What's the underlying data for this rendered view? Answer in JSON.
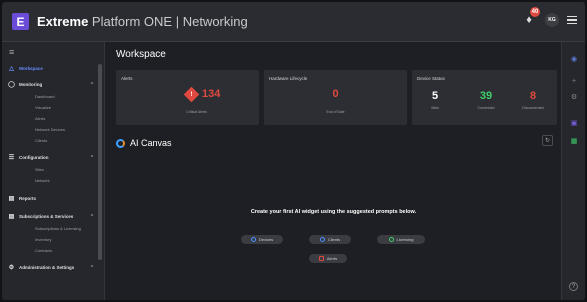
{
  "header": {
    "brand_bold": "Extreme",
    "brand_rest": " Platform ONE | Networking",
    "logo_letter": "E",
    "notification_count": "40",
    "avatar_initials": "KG"
  },
  "sidebar": {
    "items": [
      {
        "label": "Workspace",
        "icon": "workspace-icon",
        "active": true
      },
      {
        "label": "Monitoring",
        "icon": "monitor-icon",
        "expanded": true,
        "children": [
          "Dashboard",
          "Visualize",
          "Alerts",
          "Network Devices",
          "Clients"
        ]
      },
      {
        "label": "Configuration",
        "icon": "config-icon",
        "expanded": true,
        "children": [
          "Sites",
          "Network"
        ]
      },
      {
        "label": "Reports",
        "icon": "reports-icon"
      },
      {
        "label": "Subscriptions & Services",
        "icon": "subscriptions-icon",
        "expanded": true,
        "children": [
          "Subscriptions & Licensing",
          "Inventory",
          "Contracts"
        ]
      },
      {
        "label": "Administration & Settings",
        "icon": "admin-icon",
        "expanded": true
      }
    ]
  },
  "main": {
    "title": "Workspace",
    "cards": {
      "alerts": {
        "title": "Alerts",
        "value": "134",
        "caption": "Critical Alerts"
      },
      "hardware": {
        "title": "Hardware Lifecycle",
        "value": "0",
        "caption": "End of Sale"
      },
      "device_status": {
        "title": "Device Status",
        "stats": [
          {
            "value": "5",
            "caption": "Sites",
            "color": "#ffffff"
          },
          {
            "value": "39",
            "caption": "Connected",
            "color": "#3fcf6a"
          },
          {
            "value": "8",
            "caption": "Disconnected",
            "color": "#e0493f"
          }
        ]
      }
    },
    "ai_canvas": {
      "title": "AI Canvas",
      "prompt": "Create your first AI widget using the suggested prompts below.",
      "chips": [
        {
          "label": "Devices",
          "color": "#4a8cff"
        },
        {
          "label": "Clients",
          "color": "#4a8cff"
        },
        {
          "label": "Licensing",
          "color": "#3fcf6a"
        },
        {
          "label": "Alerts",
          "color": "#e0493f"
        }
      ]
    }
  },
  "colors": {
    "accent": "#6b4cd8",
    "critical": "#e0493f",
    "ok": "#3fcf6a"
  }
}
